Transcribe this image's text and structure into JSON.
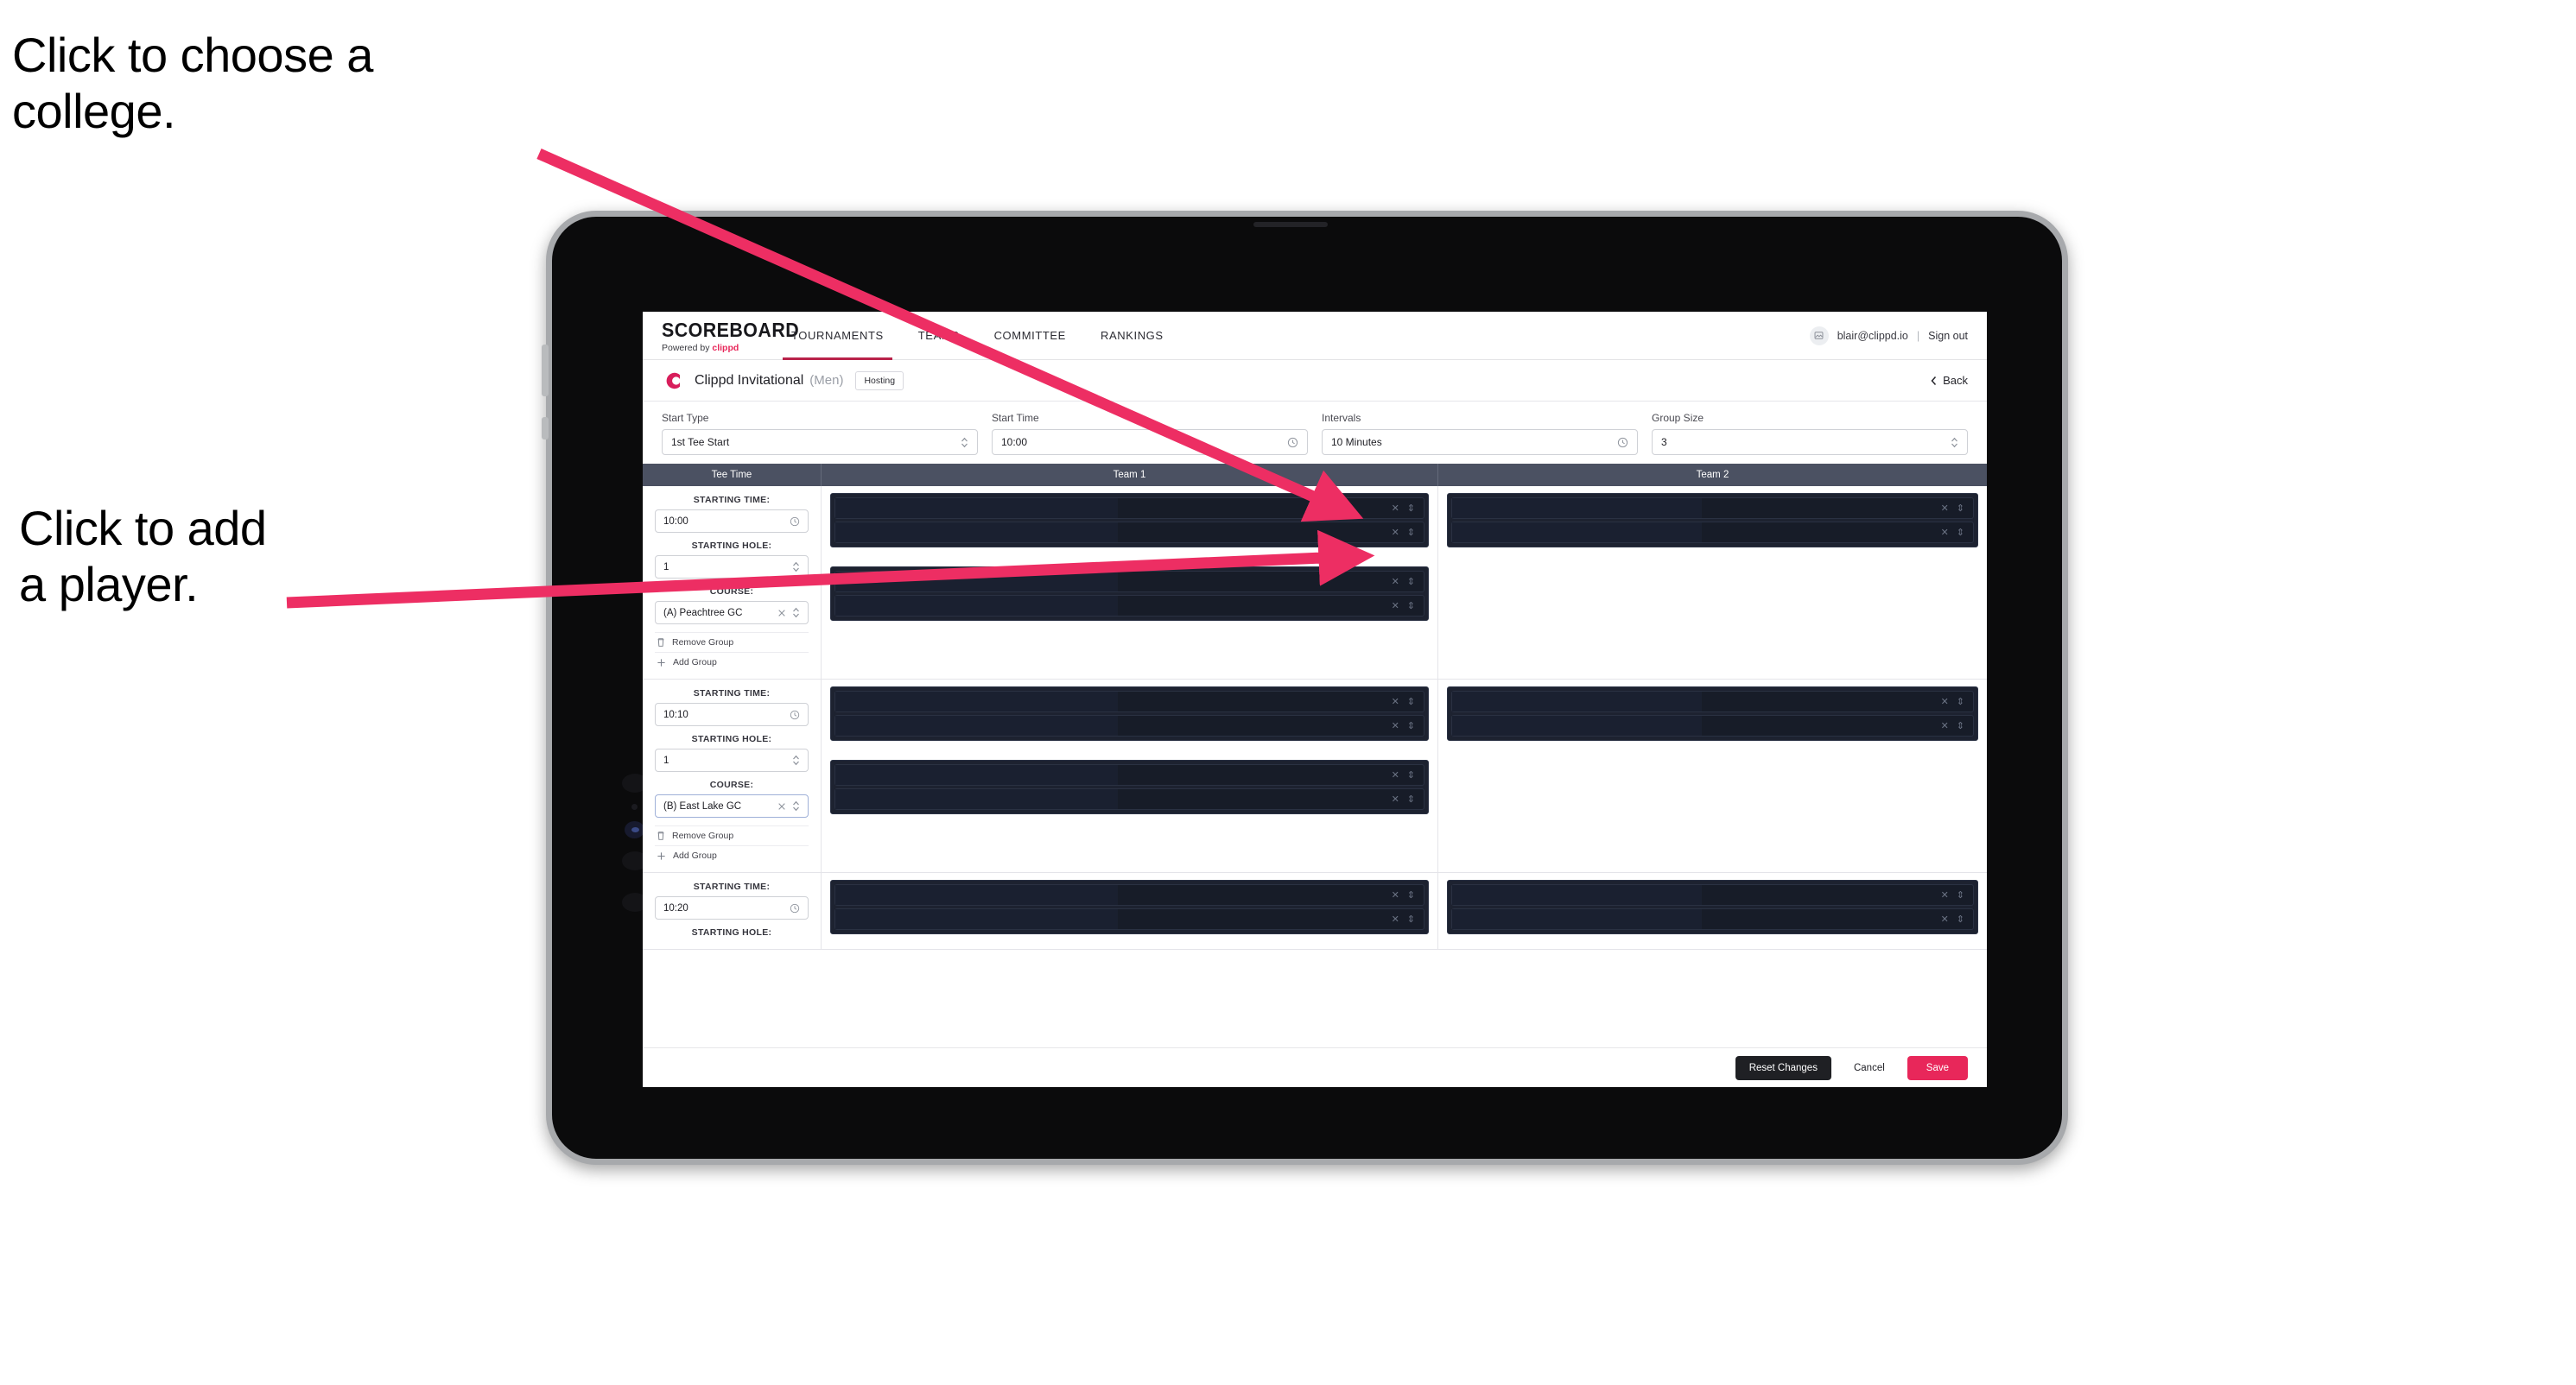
{
  "annotations": {
    "college": "Click to choose a\ncollege.",
    "player": "Click to add\na player.",
    "arrow_color": "#ED2E63"
  },
  "app": {
    "brand": {
      "name": "SCOREBOARD",
      "powered_by_prefix": "Powered by ",
      "powered_by_brand": "clippd"
    },
    "nav_tabs": [
      {
        "label": "TOURNAMENTS",
        "active": true
      },
      {
        "label": "TEAMS",
        "active": false
      },
      {
        "label": "COMMITTEE",
        "active": false
      },
      {
        "label": "RANKINGS",
        "active": false
      }
    ],
    "account": {
      "avatar_icon": "user-image-icon",
      "email": "blair@clippd.io",
      "separator": "|",
      "sign_out": "Sign out"
    },
    "subheader": {
      "logo_icon": "clippd-c-logo-icon",
      "tournament": "Clippd Invitational",
      "gender": "(Men)",
      "badge": "Hosting",
      "back_label": "Back",
      "back_icon": "chevron-left-icon"
    },
    "controls": [
      {
        "label": "Start Type",
        "value": "1st Tee Start",
        "icon": "stepper-updown-icon"
      },
      {
        "label": "Start Time",
        "value": "10:00",
        "icon": "clock-icon"
      },
      {
        "label": "Intervals",
        "value": "10 Minutes",
        "icon": "clock-icon"
      },
      {
        "label": "Group Size",
        "value": "3",
        "icon": "stepper-updown-icon"
      }
    ],
    "table": {
      "columns": [
        "Tee Time",
        "Team 1",
        "Team 2"
      ],
      "field_labels": {
        "time": "STARTING TIME:",
        "hole": "STARTING HOLE:",
        "course": "COURSE:"
      },
      "group_actions": {
        "remove": "Remove Group",
        "remove_icon": "trash-icon",
        "add": "Add Group",
        "add_icon": "plus-icon"
      },
      "player_row_icons": {
        "clear": "close-x-icon",
        "stepper": "stepper-updown-icon"
      },
      "groups": [
        {
          "time": "10:00",
          "hole": "1",
          "course": "(A) Peachtree GC",
          "course_focused": false,
          "team1": [
            {
              "players": 2
            },
            {
              "players": 2
            }
          ],
          "team2": [
            {
              "players": 2
            }
          ]
        },
        {
          "time": "10:10",
          "hole": "1",
          "course": "(B) East Lake GC",
          "course_focused": true,
          "team1": [
            {
              "players": 2
            },
            {
              "players": 2
            }
          ],
          "team2": [
            {
              "players": 2
            }
          ]
        },
        {
          "time": "10:20",
          "hole": "",
          "course": "",
          "course_focused": false,
          "team1": [
            {
              "players": 2
            }
          ],
          "team2": [
            {
              "players": 2
            }
          ]
        }
      ]
    },
    "footer": {
      "reset": "Reset Changes",
      "cancel": "Cancel",
      "save": "Save",
      "save_color": "#E8275A",
      "reset_color": "#1F2024"
    }
  }
}
